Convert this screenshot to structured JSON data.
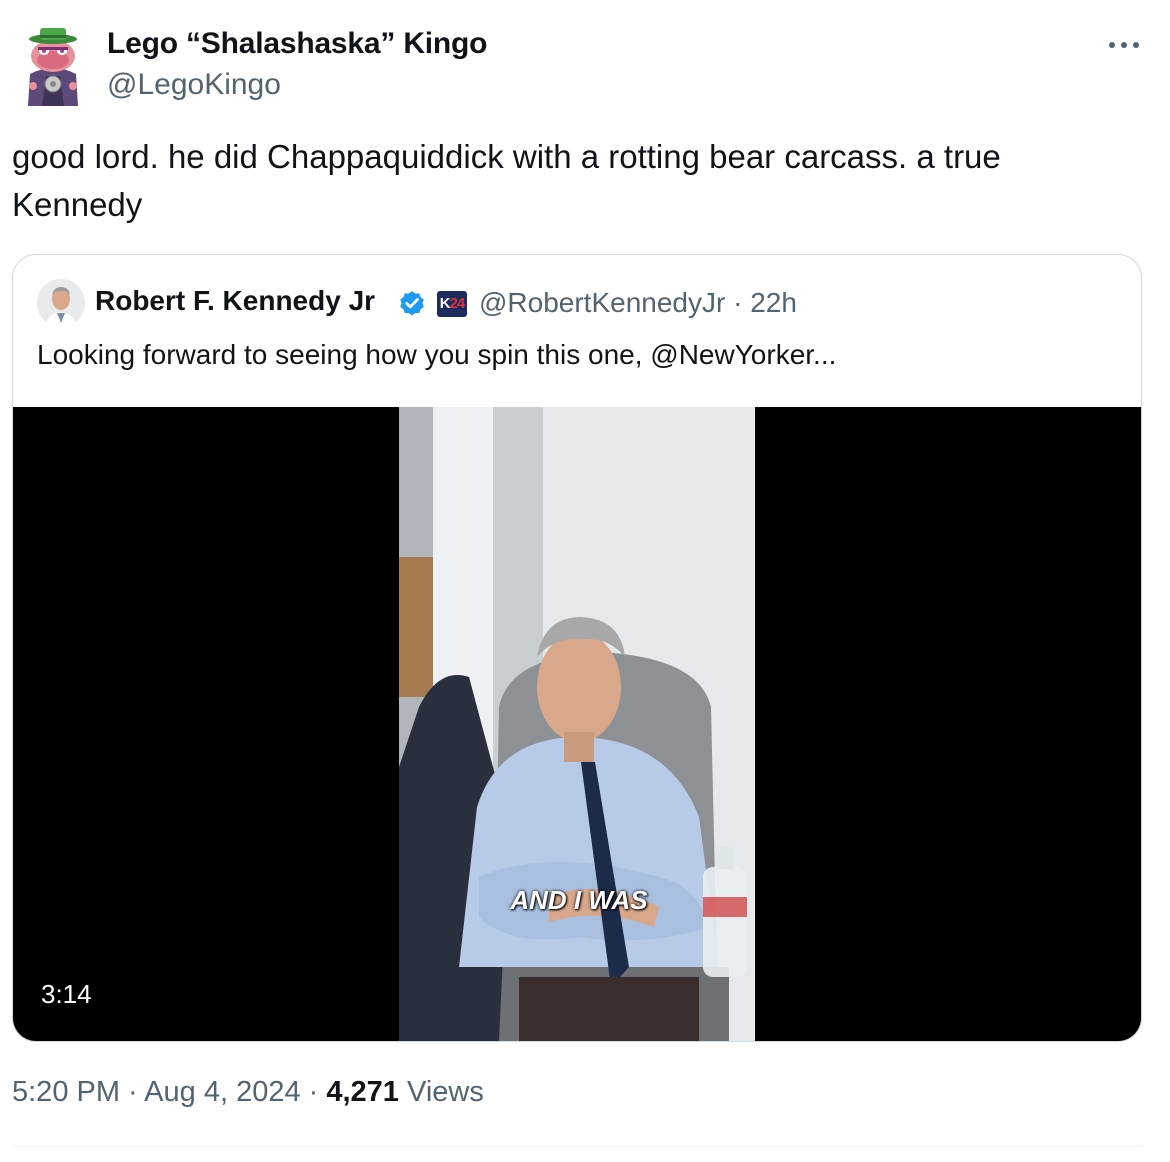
{
  "author": {
    "display_name": "Lego “Shalashaska” Kingo",
    "handle": "@LegoKingo",
    "avatar_icon": "lego-character-avatar"
  },
  "more_icon": "more-horizontal-icon",
  "tweet_text": "good lord. he did Chappaquiddick with a rotting bear carcass. a true Kennedy",
  "quoted": {
    "display_name": "Robert F. Kennedy Jr",
    "verified_icon": "verified-badge-icon",
    "badge_label_k": "K",
    "badge_label_n": "24",
    "handle_time": "@RobertKennedyJr · 22h",
    "text": "Looking forward to seeing how you spin this one, @NewYorker...",
    "video": {
      "duration": "3:14",
      "caption": "AND I WAS"
    }
  },
  "meta": {
    "time_date": "5:20 PM · Aug 4, 2024 · ",
    "views_count": "4,271",
    "views_label": " Views"
  },
  "colors": {
    "text": "#0f1419",
    "secondary": "#536471",
    "verified": "#1d9bf0",
    "border": "#cfd9de"
  }
}
